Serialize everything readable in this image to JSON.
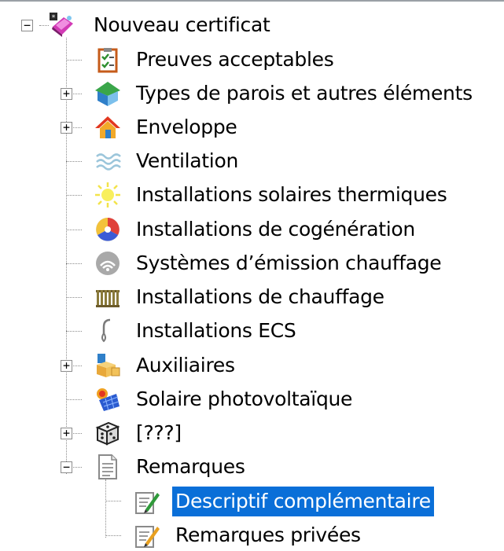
{
  "tree": {
    "root": {
      "label": "Nouveau certificat",
      "icon": "pink-certificate-icon",
      "expanded": true
    },
    "items": [
      {
        "label": "Preuves acceptables",
        "icon": "checklist-clipboard-icon"
      },
      {
        "label": "Types de parois et autres éléments",
        "icon": "green-roof-cube-icon",
        "expandable": true
      },
      {
        "label": "Enveloppe",
        "icon": "house-icon",
        "expandable": true
      },
      {
        "label": "Ventilation",
        "icon": "wavy-air-lines-icon"
      },
      {
        "label": "Installations solaires thermiques",
        "icon": "sun-icon"
      },
      {
        "label": "Installations de cogénération",
        "icon": "cogeneration-swirl-icon"
      },
      {
        "label": "Systèmes d’émission chauffage",
        "icon": "radiant-disc-icon"
      },
      {
        "label": "Installations de chauffage",
        "icon": "radiator-icon"
      },
      {
        "label": "Installations ECS",
        "icon": "water-tap-icon"
      },
      {
        "label": "Auxiliaires",
        "icon": "boxes-icon",
        "expandable": true
      },
      {
        "label": "Solaire photovoltaïque",
        "icon": "pv-panel-icon"
      },
      {
        "label": "[???]",
        "icon": "dice-icon",
        "expandable": true
      },
      {
        "label": "Remarques",
        "icon": "document-icon",
        "expandable": true,
        "expanded": true,
        "children": [
          {
            "label": "Descriptif complémentaire",
            "icon": "edit-note-icon",
            "selected": true
          },
          {
            "label": "Remarques privées",
            "icon": "edit-note-icon"
          }
        ]
      }
    ]
  },
  "colors": {
    "selection": "#0a6fd8",
    "selection_text": "#ffffff",
    "tree_lines": "#8c8c8c"
  }
}
